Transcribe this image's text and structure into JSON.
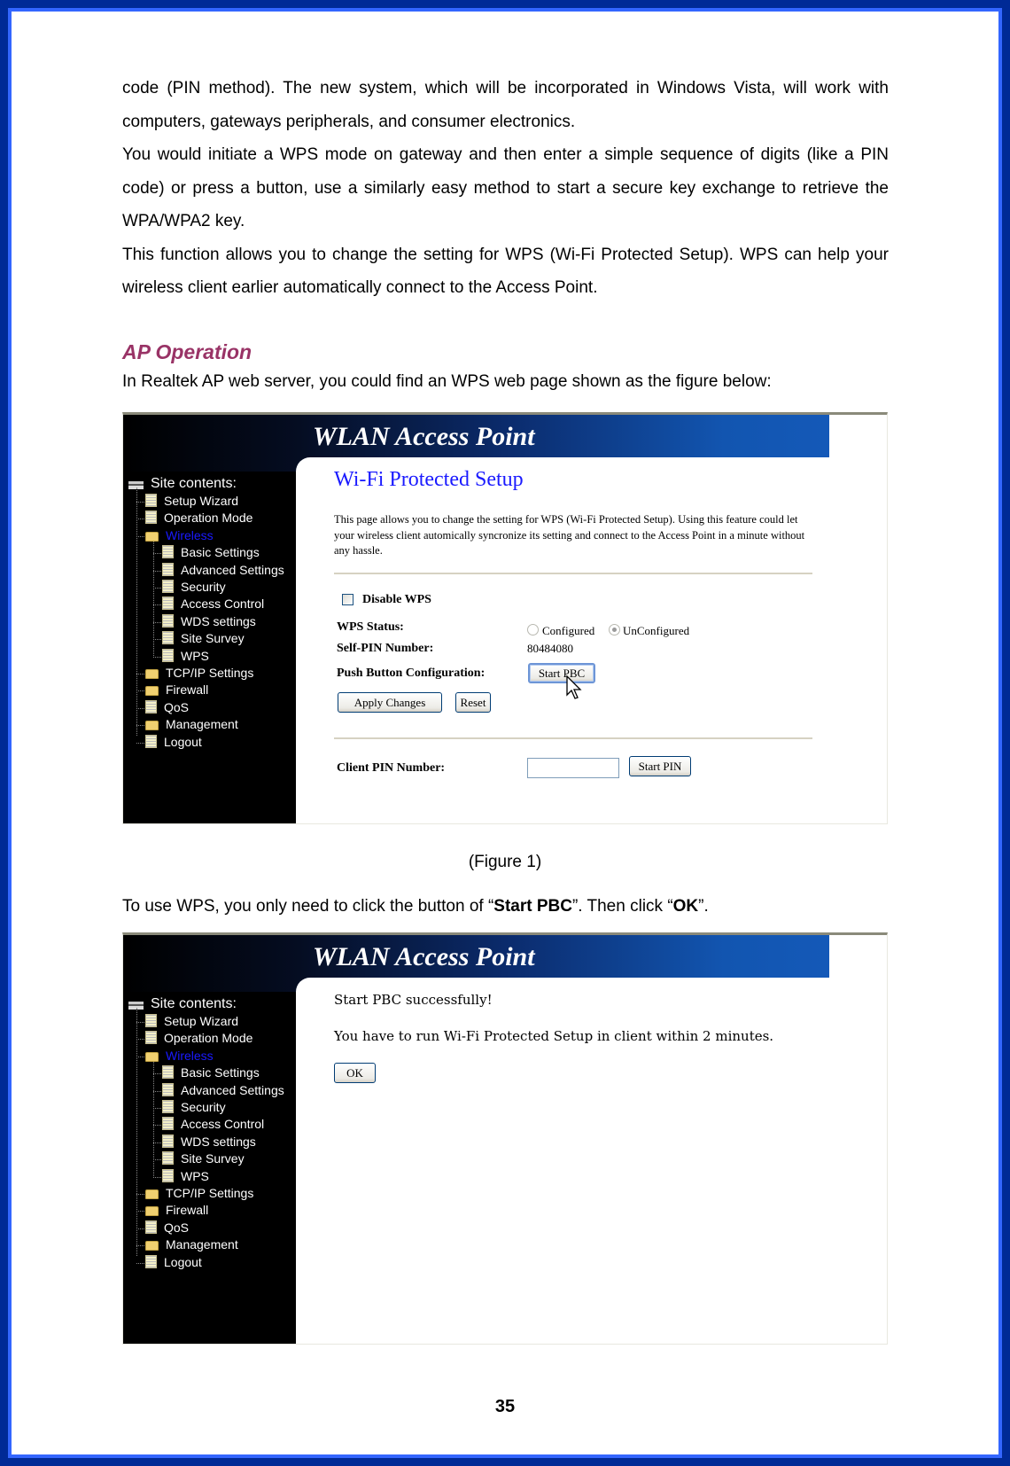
{
  "paragraphs": [
    "code (PIN method). The new system, which will be incorporated in Windows Vista, will work with computers, gateways peripherals, and consumer electronics.",
    "You would initiate a WPS mode on gateway and then enter a simple sequence of digits (like a PIN code) or press a button, use a similarly easy method to start a secure key exchange to retrieve the WPA/WPA2 key.",
    "This function allows you to change the setting for WPS (Wi-Fi Protected Setup). WPS can help your wireless client earlier automatically connect to the Access Point."
  ],
  "section_heading": "AP Operation",
  "intro": "In Realtek AP web server, you could find an WPS web page shown as the figure below:",
  "figure_caption": "(Figure 1)",
  "instruction": {
    "prefix": "To use WPS, you only need to click the button of “",
    "bold1": "Start PBC",
    "middle": "”. Then click “",
    "bold2": "OK",
    "suffix": "”."
  },
  "page_number": "35",
  "colors": {
    "frame_outer": "#002a96",
    "frame_inner": "#3366ff",
    "heading": "#993366",
    "link_blue": "#1a1aff"
  },
  "ap_ui": {
    "banner_title": "WLAN Access Point",
    "sidebar": {
      "root": "Site contents:",
      "items": [
        {
          "label": "Setup Wizard",
          "icon": "page-icon",
          "level": 1
        },
        {
          "label": "Operation Mode",
          "icon": "page-icon",
          "level": 1
        },
        {
          "label": "Wireless",
          "icon": "open-folder-icon",
          "level": 1,
          "active": true
        },
        {
          "label": "Basic Settings",
          "icon": "page-icon",
          "level": 2
        },
        {
          "label": "Advanced Settings",
          "icon": "page-icon",
          "level": 2
        },
        {
          "label": "Security",
          "icon": "page-icon",
          "level": 2
        },
        {
          "label": "Access Control",
          "icon": "page-icon",
          "level": 2
        },
        {
          "label": "WDS settings",
          "icon": "page-icon",
          "level": 2
        },
        {
          "label": "Site Survey",
          "icon": "page-icon",
          "level": 2
        },
        {
          "label": "WPS",
          "icon": "page-icon",
          "level": 2
        },
        {
          "label": "TCP/IP Settings",
          "icon": "folder-icon",
          "level": 1
        },
        {
          "label": "Firewall",
          "icon": "folder-icon",
          "level": 1
        },
        {
          "label": "QoS",
          "icon": "page-icon",
          "level": 1
        },
        {
          "label": "Management",
          "icon": "folder-icon",
          "level": 1
        },
        {
          "label": "Logout",
          "icon": "page-icon",
          "level": 1
        }
      ]
    },
    "wps_page": {
      "title": "Wi-Fi Protected Setup",
      "description": "This page allows you to change the setting for WPS (Wi-Fi Protected Setup). Using this feature could let your wireless client automically syncronize its setting and connect to the Access Point in a minute without any hassle.",
      "disable_wps_label": "Disable WPS",
      "disable_wps_checked": false,
      "wps_status_label": "WPS Status:",
      "status_options": [
        "Configured",
        "UnConfigured"
      ],
      "status_selected": "UnConfigured",
      "self_pin_label": "Self-PIN Number:",
      "self_pin_value": "80484080",
      "push_button_label": "Push Button Configuration:",
      "start_pbc_button": "Start PBC",
      "apply_button": "Apply Changes",
      "reset_button": "Reset",
      "client_pin_label": "Client PIN Number:",
      "client_pin_value": "",
      "start_pin_button": "Start PIN"
    },
    "pbc_page": {
      "message1": "Start PBC successfully!",
      "message2": "You have to run Wi-Fi Protected Setup in client within 2 minutes.",
      "ok_button": "OK"
    }
  }
}
